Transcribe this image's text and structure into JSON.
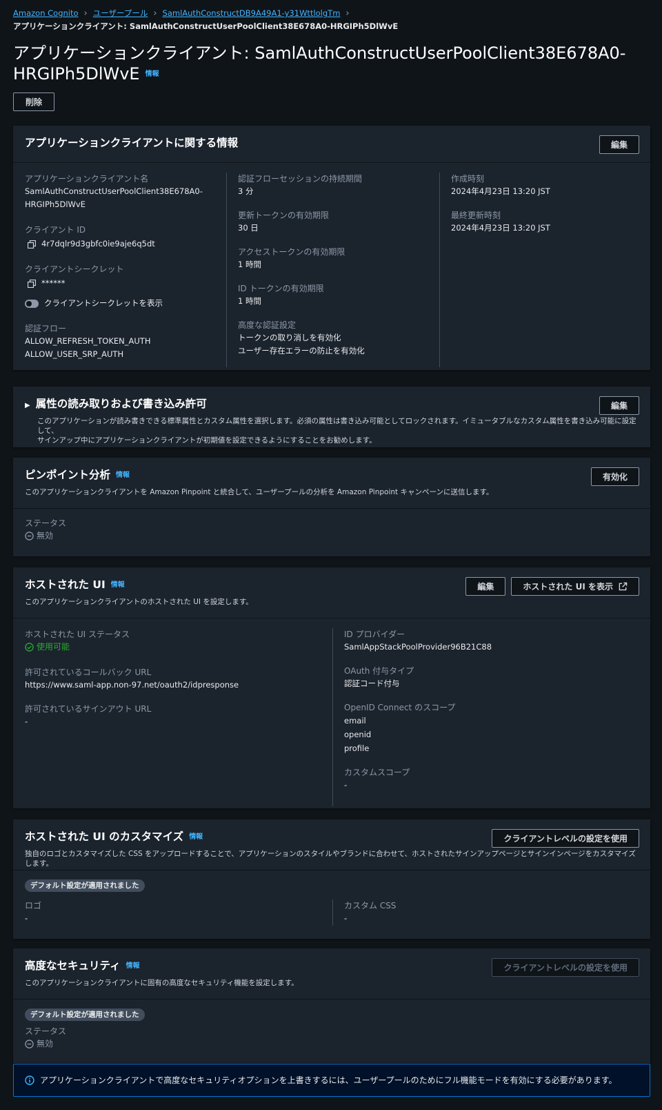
{
  "breadcrumb": {
    "items": [
      "Amazon Cognito",
      "ユーザープール",
      "SamlAuthConstructDB9A49A1-y31WttlolgTm"
    ],
    "current": "アプリケーションクライアント: SamlAuthConstructUserPoolClient38E678A0-HRGIPh5DlWvE"
  },
  "page": {
    "title_line1": "アプリケーションクライアント: SamlAuthConstructUserPoolClient38E678A0-",
    "title_line2": "HRGIPh5DlWvE",
    "info": "情報",
    "delete_label": "削除"
  },
  "client_info": {
    "title": "アプリケーションクライアントに関する情報",
    "edit_label": "編集",
    "name_label": "アプリケーションクライアント名",
    "name_line1": "SamlAuthConstructUserPoolClient38E678A0-",
    "name_line2": "HRGIPh5DlWvE",
    "client_id_label": "クライアント ID",
    "client_id": "4r7dqlr9d3gbfc0ie9aje6q5dt",
    "secret_label": "クライアントシークレット",
    "secret": "******",
    "show_secret_label": "クライアントシークレットを表示",
    "auth_flow_label": "認証フロー",
    "auth_flows": [
      "ALLOW_REFRESH_TOKEN_AUTH",
      "ALLOW_USER_SRP_AUTH"
    ],
    "session_label": "認証フローセッションの持続期間",
    "session_value": "3 分",
    "refresh_label": "更新トークンの有効期限",
    "refresh_value": "30 日",
    "access_label": "アクセストークンの有効期限",
    "access_value": "1 時間",
    "id_token_label": "ID トークンの有効期限",
    "id_token_value": "1 時間",
    "advanced_auth_label": "高度な認証設定",
    "advanced_auth_values": [
      "トークンの取り消しを有効化",
      "ユーザー存在エラーの防止を有効化"
    ],
    "created_label": "作成時刻",
    "created_value": "2024年4月23日 13:20 JST",
    "updated_label": "最終更新時刻",
    "updated_value": "2024年4月23日 13:20 JST"
  },
  "attributes": {
    "title": "属性の読み取りおよび書き込み許可",
    "edit_label": "編集",
    "desc_line1": "このアプリケーションが読み書きできる標準属性とカスタム属性を選択します。必須の属性は書き込み可能としてロックされます。イミュータブルなカスタム属性を書き込み可能に設定して、",
    "desc_line2": "サインアップ中にアプリケーションクライアントが初期値を設定できるようにすることをお勧めします。"
  },
  "pinpoint": {
    "title": "ピンポイント分析",
    "info": "情報",
    "enable_label": "有効化",
    "desc": "このアプリケーションクライアントを Amazon Pinpoint と統合して、ユーザープールの分析を Amazon Pinpoint キャンペーンに送信します。",
    "status_label": "ステータス",
    "status_value": "無効"
  },
  "hosted_ui": {
    "title": "ホストされた UI",
    "info": "情報",
    "edit_label": "編集",
    "view_label": "ホストされた UI を表示",
    "desc": "このアプリケーションクライアントのホストされた UI を設定します。",
    "status_label": "ホストされた UI ステータス",
    "status_value": "使用可能",
    "callback_label": "許可されているコールバック URL",
    "callback_value": "https://www.saml-app.non-97.net/oauth2/idpresponse",
    "signout_label": "許可されているサインアウト URL",
    "signout_value": "-",
    "idp_label": "ID プロバイダー",
    "idp_value": "SamlAppStackPoolProvider96B21C88",
    "oauth_label": "OAuth 付与タイプ",
    "oauth_value": "認証コード付与",
    "scopes_label": "OpenID Connect のスコープ",
    "scopes": [
      "email",
      "openid",
      "profile"
    ],
    "custom_scope_label": "カスタムスコープ",
    "custom_scope_value": "-"
  },
  "customize": {
    "title": "ホストされた UI のカスタマイズ",
    "info": "情報",
    "button_label": "クライアントレベルの設定を使用",
    "desc": "独自のロゴとカスタマイズした CSS をアップロードすることで、アプリケーションのスタイルやブランドに合わせて、ホストされたサインアップページとサインインページをカスタマイズします。",
    "badge": "デフォルト設定が適用されました",
    "logo_label": "ロゴ",
    "logo_value": "-",
    "css_label": "カスタム CSS",
    "css_value": "-"
  },
  "security": {
    "title": "高度なセキュリティ",
    "info": "情報",
    "button_label": "クライアントレベルの設定を使用",
    "desc": "このアプリケーションクライアントに固有の高度なセキュリティ機能を設定します。",
    "badge": "デフォルト設定が適用されました",
    "status_label": "ステータス",
    "status_value": "無効"
  },
  "flash": {
    "message": "アプリケーションクライアントで高度なセキュリティオプションを上書きするには、ユーザープールのためにフル機能モードを有効にする必要があります。"
  }
}
